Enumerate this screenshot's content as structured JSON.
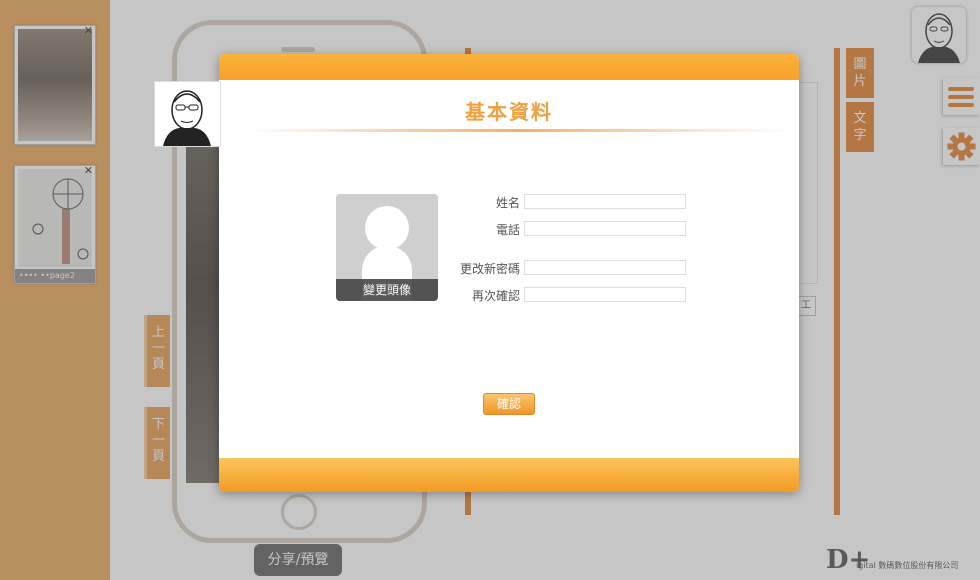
{
  "app": {
    "thumbnails": [
      {
        "caption": ""
      },
      {
        "caption": "•••• ••page2"
      }
    ],
    "nav": {
      "prev": "上\n一\n頁",
      "next": "下\n一\n頁"
    },
    "tabs": {
      "image": "圖\n片",
      "text": "文\n字"
    },
    "editor_tool_label": "工",
    "share_label": "分享/預覽",
    "brand": {
      "mark": "D+",
      "text": "igital 數碼數位股份有限公司"
    }
  },
  "modal": {
    "title": "基本資料",
    "avatar_label": "變更頭像",
    "fields": {
      "name": {
        "label": "姓名",
        "value": ""
      },
      "phone": {
        "label": "電話",
        "value": ""
      },
      "new_password": {
        "label": "更改新密碼",
        "value": ""
      },
      "confirm_password": {
        "label": "再次確認",
        "value": ""
      }
    },
    "confirm_label": "確認"
  },
  "colors": {
    "accent": "#f0a03c",
    "orange_dark": "#e07820",
    "left_panel": "#e8a050"
  }
}
